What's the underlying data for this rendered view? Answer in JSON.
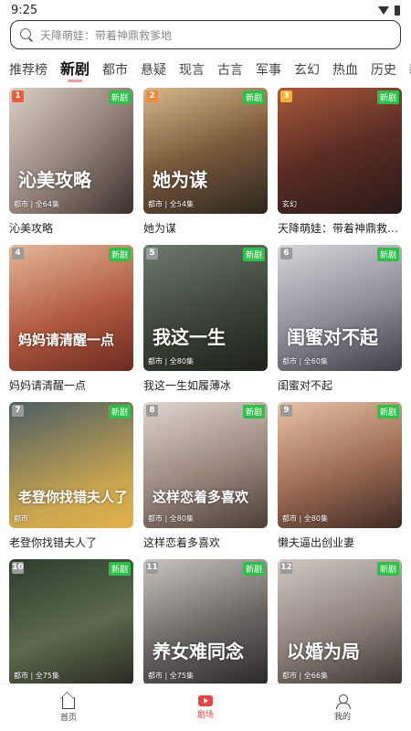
{
  "status": {
    "time": "9:25"
  },
  "search": {
    "placeholder": "天降萌娃：带着神鼎救爹地"
  },
  "tabs": [
    "推荐榜",
    "新剧",
    "都市",
    "悬疑",
    "现言",
    "古言",
    "军事",
    "玄幻",
    "热血",
    "历史",
    "新"
  ],
  "active_tab": "新剧",
  "badge_text": "新剧",
  "dramas": [
    {
      "rank": "1",
      "title": "沁美攻略",
      "meta": "都市 | 全64集",
      "poster_text": "沁美攻略",
      "rank_color": "#ef5a3a",
      "bg": "linear-gradient(135deg,#d9cfc8,#8f7d74 55%,#3b2f2c)"
    },
    {
      "rank": "2",
      "title": "她为谋",
      "meta": "都市 | 全54集",
      "poster_text": "她为谋",
      "rank_color": "#f08a3a",
      "bg": "linear-gradient(160deg,#d8b98c,#7b5a3b 50%,#2d2620)"
    },
    {
      "rank": "3",
      "title": "天降萌娃：带着神鼎救爹地",
      "meta": "玄幻",
      "poster_text": "",
      "rank_color": "#f2b234",
      "bg": "linear-gradient(160deg,#a85a3a,#5b2c24 50%,#2a1a18)"
    },
    {
      "rank": "4",
      "title": "妈妈请清醒一点",
      "meta": "",
      "poster_text": "妈妈请清醒一点",
      "rank_color": "#9a9a9a",
      "bg": "linear-gradient(160deg,#e4b79a,#b05a3e 55%,#6b2a22)"
    },
    {
      "rank": "5",
      "title": "我这一生如履薄冰",
      "meta": "都市 | 全80集",
      "poster_text": "我这一生",
      "rank_color": "#9a9a9a",
      "bg": "linear-gradient(160deg,#6d7a6c,#3d4438 55%,#1d211b)"
    },
    {
      "rank": "6",
      "title": "闺蜜对不起",
      "meta": "都市 | 全60集",
      "poster_text": "闺蜜对不起",
      "rank_color": "#9a9a9a",
      "bg": "linear-gradient(160deg,#d6d6da,#8b8c96 55%,#3d3e48)"
    },
    {
      "rank": "7",
      "title": "老登你找错夫人了",
      "meta": "都市",
      "poster_text": "老登你找错夫人了",
      "rank_color": "#9a9a9a",
      "bg": "linear-gradient(160deg,#4c5e63,#c9a54f 70%,#e2b04a)"
    },
    {
      "rank": "8",
      "title": "这样恋着多喜欢",
      "meta": "都市 | 全80集",
      "poster_text": "这样恋着多喜欢",
      "rank_color": "#9a9a9a",
      "bg": "linear-gradient(160deg,#e0d6d0,#9a857c 55%,#4c3d37)"
    },
    {
      "rank": "9",
      "title": "懒夫逼出创业妻",
      "meta": "都市 | 全80集",
      "poster_text": "",
      "rank_color": "#9a9a9a",
      "bg": "linear-gradient(160deg,#e7c3a8,#9b6a52 55%,#3e2a24)"
    },
    {
      "rank": "10",
      "title": "",
      "meta": "都市 | 全75集",
      "poster_text": "",
      "rank_color": "#9a9a9a",
      "bg": "linear-gradient(160deg,#2b3d2e,#5b6a4c 55%,#2a2a22)"
    },
    {
      "rank": "11",
      "title": "",
      "meta": "都市 | 全75集",
      "poster_text": "养女难同念",
      "rank_color": "#9a9a9a",
      "bg": "linear-gradient(160deg,#c9c4c0,#6a6563 55%,#2a2828)"
    },
    {
      "rank": "12",
      "title": "",
      "meta": "都市 | 全66集",
      "poster_text": "以婚为局",
      "rank_color": "#9a9a9a",
      "bg": "linear-gradient(160deg,#cfc9c2,#8c8079 55%,#3d3632)"
    }
  ],
  "bottom_nav": [
    {
      "label": "首页",
      "icon": "home-icon"
    },
    {
      "label": "剧场",
      "icon": "play-icon"
    },
    {
      "label": "我的",
      "icon": "user-icon"
    }
  ],
  "active_nav": "剧场",
  "accent_color": "#e64545",
  "badge_color": "#2fbf4a"
}
